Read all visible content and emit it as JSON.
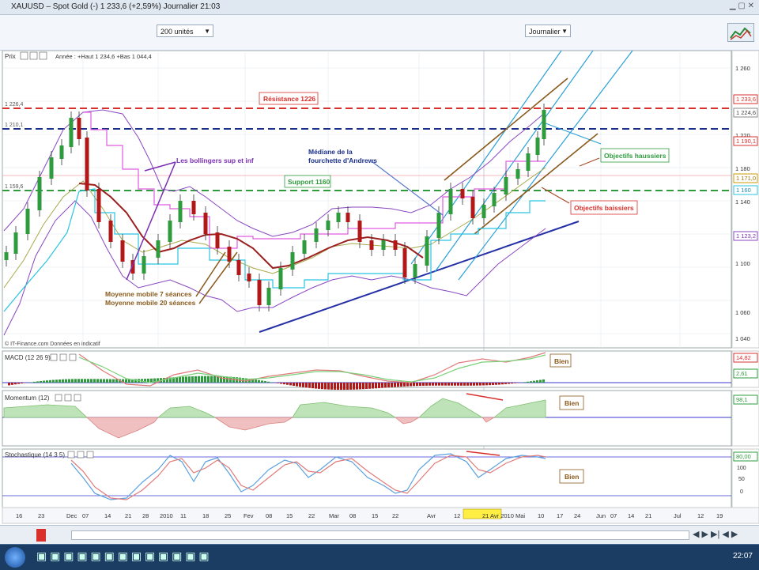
{
  "window": {
    "title": "XAUUSD – Spot Gold (-) 1 233,6 (+2,59%) Journalier 21:03"
  },
  "toolbar": {
    "period_select": "200 unités",
    "interval_select": "Journalier"
  },
  "price_panel": {
    "label": "Prix",
    "info": "Année : +Haut 1 234,6 +Bas 1 044,4",
    "footer": "© IT-Finance.com Données en indicatif",
    "y_ticks": [
      "1 260",
      "1 220",
      "1 180",
      "1 140",
      "1 100",
      "1 060",
      "1 040"
    ],
    "badges": [
      "1 233,6",
      "1 224,6",
      "1 190,1",
      "1 171,0",
      "1 160",
      "1 123,2"
    ],
    "level_labels": {
      "l1": "1 226,4",
      "l2": "1 210,1",
      "l3": "1 159,6"
    },
    "annotations": {
      "resistance": "Résistance 1226",
      "support": "Support 1160",
      "bollinger": "Les bollingers sup et inf",
      "median1": "Médiane de la",
      "median2": "fourchette d'Andrews",
      "ma7": "Moyenne mobile 7 séances",
      "ma20": "Moyenne mobile 20 séances",
      "obj_up": "Objectifs haussiers",
      "obj_down": "Objectifs baissiers"
    },
    "colors": {
      "resistance": "#d9302c",
      "median": "#1a2f8a",
      "support": "#2e9b3d",
      "bollinger": "#7b2fb3",
      "pitchfork": "#2b9fd8",
      "ma": "#9b1f1f",
      "channel": "#8a5a1c"
    }
  },
  "macd_panel": {
    "label": "MACD (12 26 9)",
    "note": "Bien",
    "badges": [
      "14,82",
      "2,61"
    ]
  },
  "momentum_panel": {
    "label": "Momentum (12)",
    "note": "Bien",
    "badges": [
      "98,1"
    ]
  },
  "stoch_panel": {
    "label": "Stochastique (14 3 5)",
    "note": "Bien",
    "badges": [
      "80,00"
    ],
    "y_ticks": [
      "100",
      "50",
      "0"
    ]
  },
  "x_axis": {
    "labels": [
      "16",
      "23",
      "Dec",
      "07",
      "14",
      "21",
      "28",
      "2010",
      "11",
      "18",
      "25",
      "Fev",
      "08",
      "15",
      "22",
      "Mar",
      "08",
      "15",
      "22",
      "Avr",
      "12",
      "21 Avr 2010",
      "Mai",
      "10",
      "17",
      "24",
      "Jun",
      "07",
      "14",
      "21",
      "Jul",
      "12",
      "19"
    ]
  },
  "taskbar": {
    "clock": "22:07"
  }
}
